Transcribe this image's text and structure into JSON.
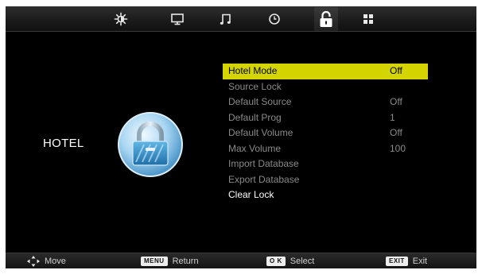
{
  "tabs": [
    {
      "icon": "picture-settings-icon",
      "active": false
    },
    {
      "icon": "screen-icon",
      "active": false
    },
    {
      "icon": "music-note-icon",
      "active": false
    },
    {
      "icon": "clock-icon",
      "active": false
    },
    {
      "icon": "lock-icon",
      "active": true
    },
    {
      "icon": "grid-icon",
      "active": false
    }
  ],
  "section": {
    "title": "HOTEL",
    "icon": "padlock-badge-icon"
  },
  "menu": {
    "items": [
      {
        "label": "Hotel Mode",
        "value": "Off",
        "state": "selected"
      },
      {
        "label": "Source Lock",
        "value": "",
        "state": "dim"
      },
      {
        "label": "Default Source",
        "value": "Off",
        "state": "dim"
      },
      {
        "label": "Default Prog",
        "value": "1",
        "state": "dim"
      },
      {
        "label": "Default Volume",
        "value": "Off",
        "state": "dim"
      },
      {
        "label": "Max Volume",
        "value": "100",
        "state": "dim"
      },
      {
        "label": "Import Database",
        "value": "",
        "state": "dim"
      },
      {
        "label": "Export Database",
        "value": "",
        "state": "dim"
      },
      {
        "label": "Clear Lock",
        "value": "",
        "state": "bright"
      }
    ]
  },
  "help": {
    "move_label": "Move",
    "menu_key": "MENU",
    "return_label": "Return",
    "ok_key": "O K",
    "select_label": "Select",
    "exit_key": "EXIT",
    "exit_label": "Exit"
  },
  "colors": {
    "highlight": "#d4d400",
    "background": "#000000",
    "dim_text": "#8a8a8a",
    "bright_text": "#ffffff"
  }
}
